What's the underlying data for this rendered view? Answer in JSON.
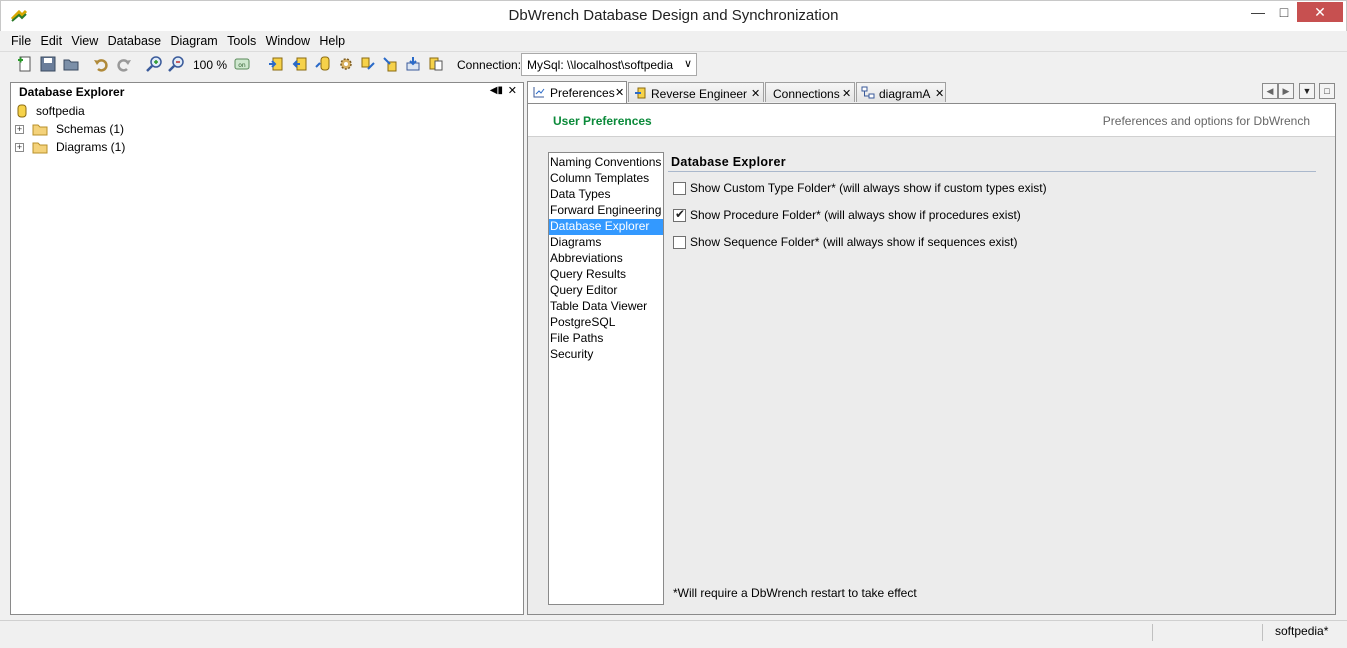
{
  "window": {
    "title": "DbWrench Database Design and Synchronization",
    "minimize": "—",
    "maximize": "□",
    "close": "✕"
  },
  "menu": [
    "File",
    "Edit",
    "View",
    "Database",
    "Diagram",
    "Tools",
    "Window",
    "Help"
  ],
  "toolbar": {
    "zoom": "100 %",
    "connection_label": "Connection:",
    "connection_value": "MySql: \\\\localhost\\softpedia"
  },
  "explorer": {
    "title": "Database Explorer",
    "root": "softpedia",
    "children": [
      "Schemas (1)",
      "Diagrams (1)"
    ]
  },
  "tabs": [
    {
      "label": "Preferences",
      "active": true
    },
    {
      "label": "Reverse Engineer",
      "active": false
    },
    {
      "label": "Connections",
      "active": false
    },
    {
      "label": "diagramA",
      "active": false
    }
  ],
  "preferences": {
    "title": "User Preferences",
    "subtitle": "Preferences and options for DbWrench",
    "categories": [
      "Naming Conventions",
      "Column Templates",
      "Data Types",
      "Forward Engineering",
      "Database Explorer",
      "Diagrams",
      "Abbreviations",
      "Query Results",
      "Query Editor",
      "Table Data Viewer",
      "PostgreSQL",
      "File Paths",
      "Security"
    ],
    "selected": "Database Explorer",
    "section_title": "Database Explorer",
    "options": [
      {
        "label": "Show Custom Type Folder*  (will always show if custom types exist)",
        "checked": false
      },
      {
        "label": "Show Procedure Folder*  (will always show if procedures exist)",
        "checked": true
      },
      {
        "label": "Show Sequence Folder*  (will always show if sequences exist)",
        "checked": false
      }
    ],
    "note": "*Will require a DbWrench restart to take effect"
  },
  "status": {
    "right": "softpedia*"
  },
  "colors": {
    "accent_green": "#0b8a3a",
    "selection": "#3399ff",
    "close_red": "#c75050"
  }
}
